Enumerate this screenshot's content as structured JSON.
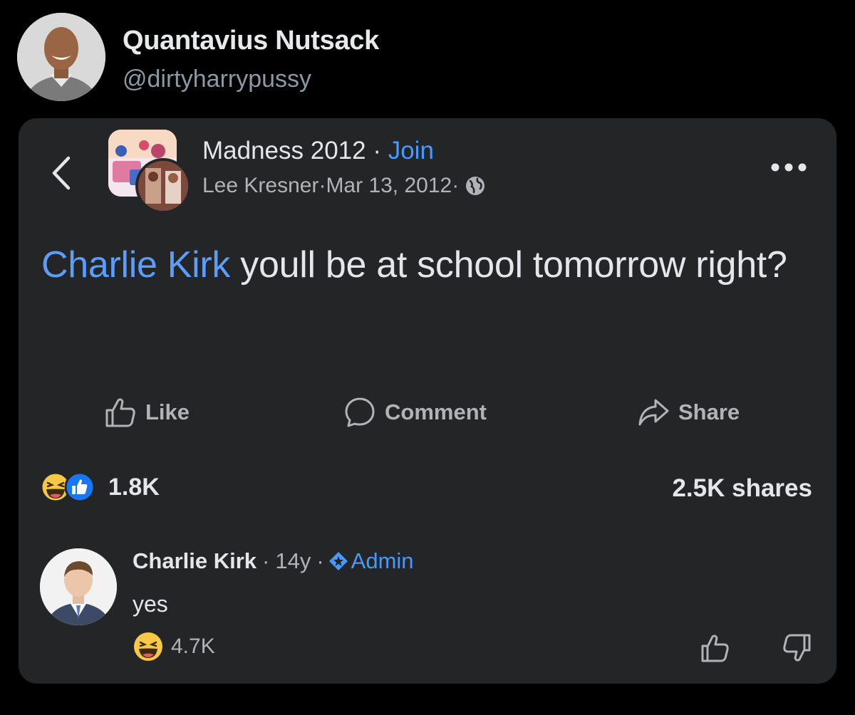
{
  "tweet": {
    "display_name": "Quantavius Nutsack",
    "handle": "@dirtyharrypussy"
  },
  "post": {
    "group_name": "Madness 2012",
    "separator": " · ",
    "join_label": "Join",
    "author": "Lee Kresner",
    "date": "Mar 13, 2012",
    "mention": "Charlie Kirk",
    "text_rest": " youll be at school tomorrow right?",
    "actions": {
      "like": "Like",
      "comment": "Comment",
      "share": "Share"
    },
    "reaction_count": "1.8K",
    "shares": "2.5K shares"
  },
  "comment": {
    "author": "Charlie Kirk",
    "age": "14y",
    "badge": "Admin",
    "text": "yes",
    "reaction_count": "4.7K"
  },
  "icons": {
    "back": "chevron-left-icon",
    "more": "more-horizontal-icon",
    "globe": "globe-icon",
    "like": "thumbs-up-icon",
    "comment": "speech-bubble-icon",
    "share": "share-arrow-icon",
    "haha": "laughing-emoji-icon",
    "like_reaction": "like-reaction-icon",
    "admin": "admin-star-badge-icon",
    "upvote": "thumbs-up-outline-icon",
    "downvote": "thumbs-down-outline-icon"
  },
  "colors": {
    "background": "#000000",
    "card": "#242526",
    "link_blue": "#4599ff",
    "mention_blue": "#5b9df9",
    "secondary_text": "#b0b3b8"
  }
}
